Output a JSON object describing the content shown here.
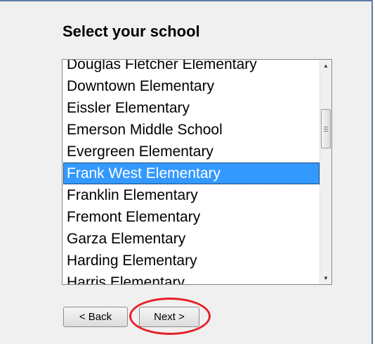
{
  "page": {
    "title": "Select your school"
  },
  "school_list": {
    "items": [
      "Douglas Fletcher Elementary",
      "Downtown Elementary",
      "Eissler Elementary",
      "Emerson Middle School",
      "Evergreen Elementary",
      "Frank West Elementary",
      "Franklin Elementary",
      "Fremont Elementary",
      "Garza Elementary",
      "Harding Elementary",
      "Harris Elementary"
    ],
    "selected_index": 5,
    "scroll_position": 0.3
  },
  "icons": {
    "scroll_up": "triangle-up-icon",
    "scroll_down": "triangle-down-icon"
  },
  "buttons": {
    "back_label": "< Back",
    "next_label": "Next >"
  },
  "colors": {
    "selection": "#3399ff",
    "highlight_ring": "#e8202a"
  }
}
